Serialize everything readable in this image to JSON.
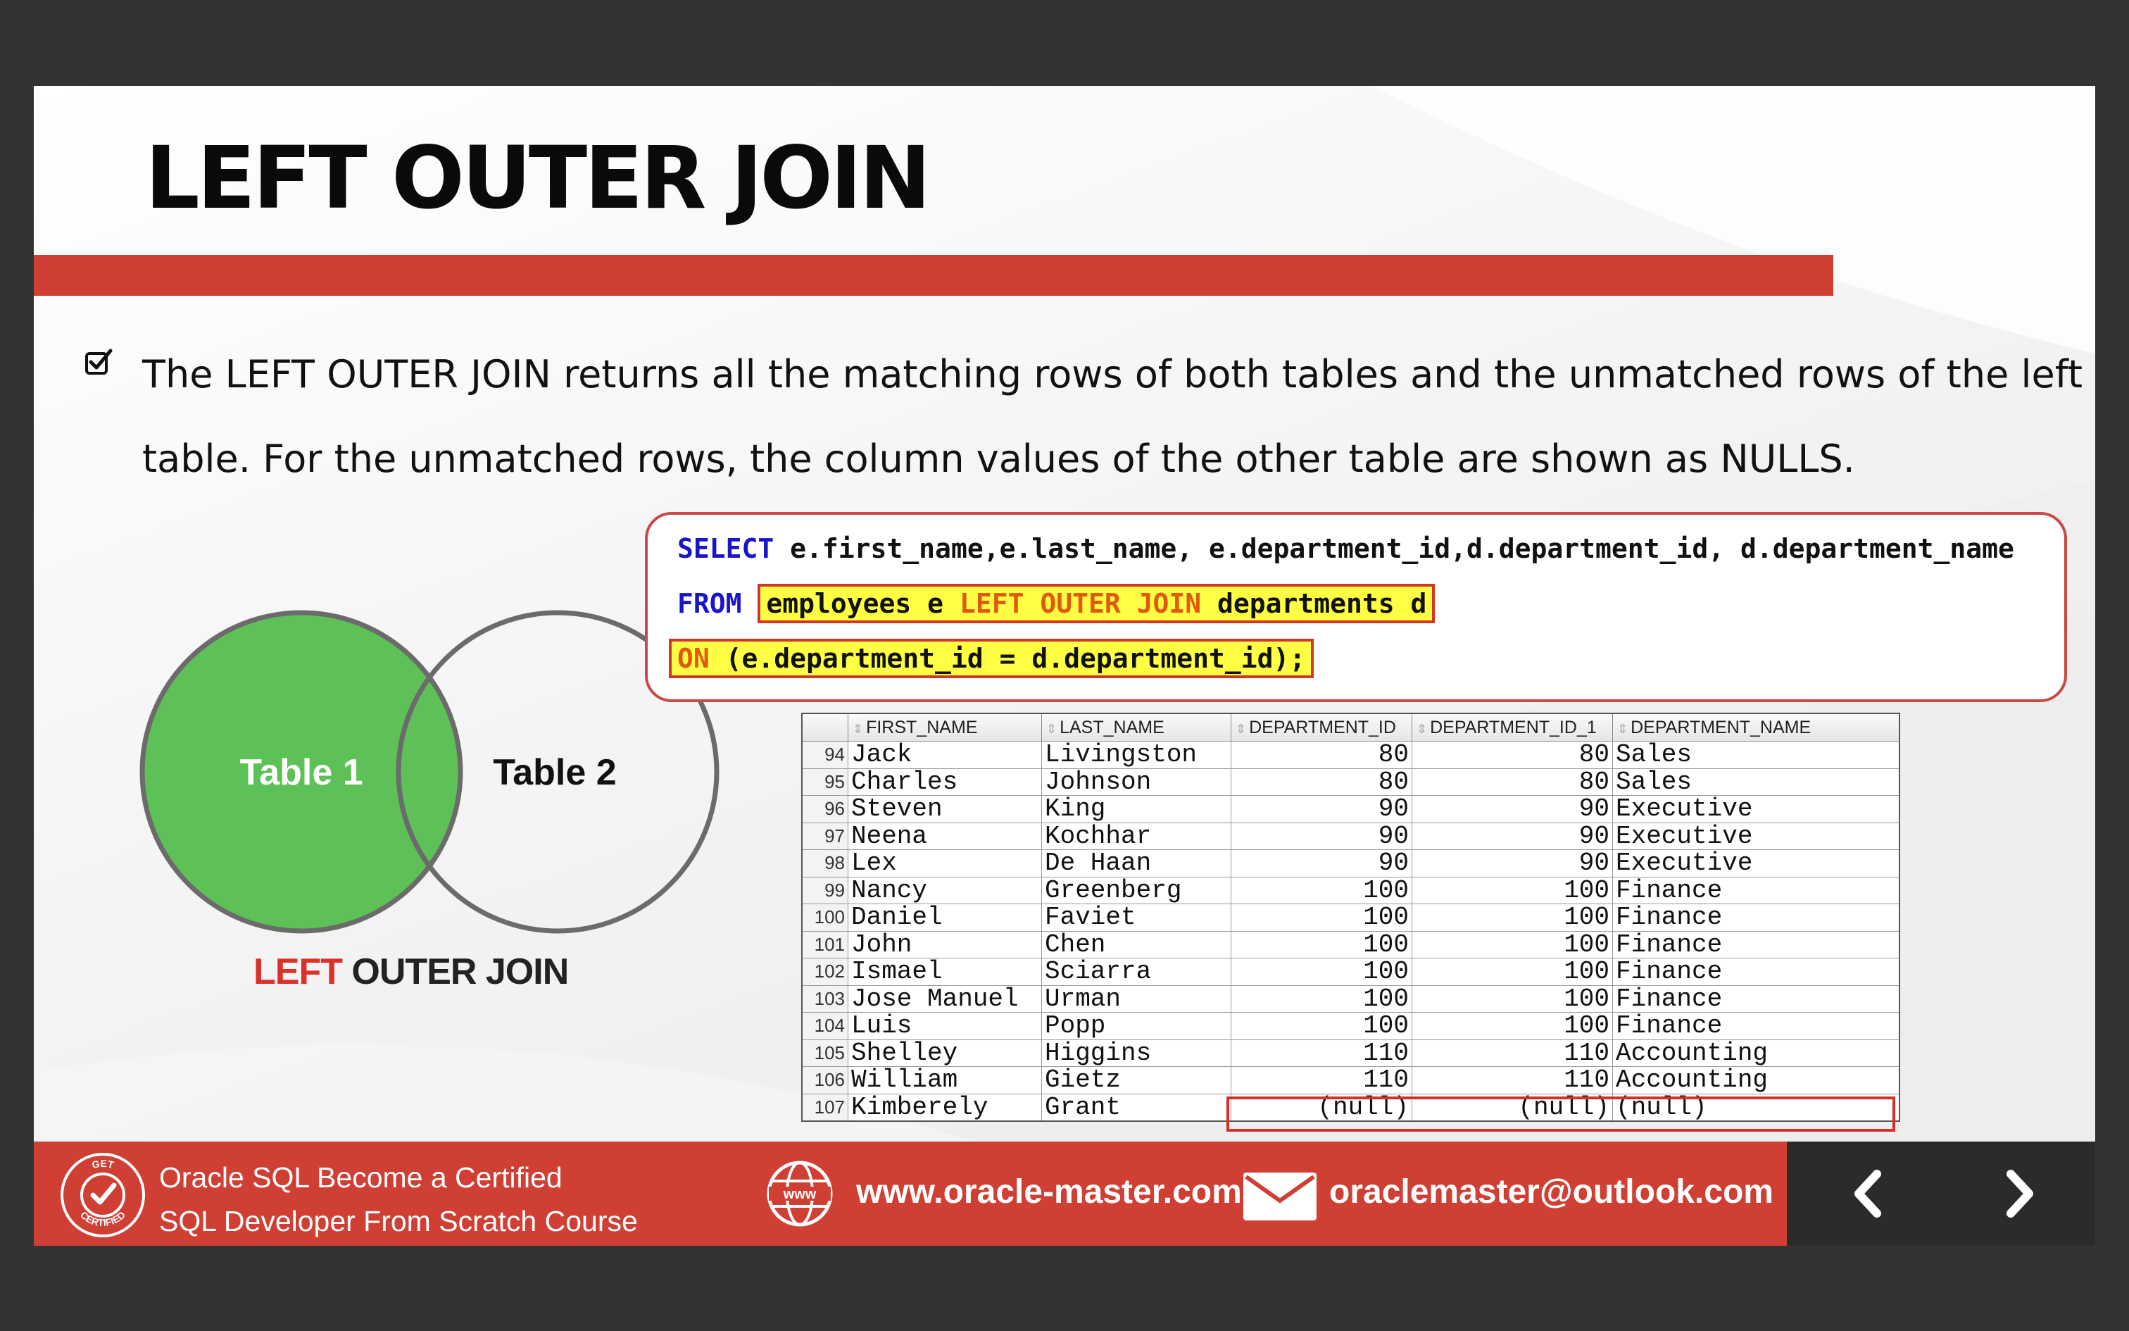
{
  "slide": {
    "title": "LEFT OUTER JOIN",
    "bullet": "The LEFT OUTER JOIN returns all the matching rows of both tables and the unmatched rows of the left table. For the unmatched rows, the column values of the other table are shown as NULLS."
  },
  "venn": {
    "table1": "Table 1",
    "table2": "Table 2",
    "caption_left": "LEFT",
    "caption_rest": " OUTER JOIN",
    "fill_color": "#5ec157"
  },
  "code": {
    "line1_kw": "SELECT",
    "line1_rest": " e.first_name,e.last_name, e.department_id,d.department_id, d.department_name",
    "line2_kw": "FROM",
    "line2_a": "employees e ",
    "line2_join": "LEFT OUTER JOIN",
    "line2_b": " departments d",
    "line3_kw": "ON",
    "line3_rest": " (e.department_id = d.department_id);"
  },
  "results": {
    "columns": [
      "FIRST_NAME",
      "LAST_NAME",
      "DEPARTMENT_ID",
      "DEPARTMENT_ID_1",
      "DEPARTMENT_NAME"
    ],
    "rows": [
      [
        "94",
        "Jack",
        "Livingston",
        "80",
        "80",
        "Sales"
      ],
      [
        "95",
        "Charles",
        "Johnson",
        "80",
        "80",
        "Sales"
      ],
      [
        "96",
        "Steven",
        "King",
        "90",
        "90",
        "Executive"
      ],
      [
        "97",
        "Neena",
        "Kochhar",
        "90",
        "90",
        "Executive"
      ],
      [
        "98",
        "Lex",
        "De Haan",
        "90",
        "90",
        "Executive"
      ],
      [
        "99",
        "Nancy",
        "Greenberg",
        "100",
        "100",
        "Finance"
      ],
      [
        "100",
        "Daniel",
        "Faviet",
        "100",
        "100",
        "Finance"
      ],
      [
        "101",
        "John",
        "Chen",
        "100",
        "100",
        "Finance"
      ],
      [
        "102",
        "Ismael",
        "Sciarra",
        "100",
        "100",
        "Finance"
      ],
      [
        "103",
        "Jose Manuel",
        "Urman",
        "100",
        "100",
        "Finance"
      ],
      [
        "104",
        "Luis",
        "Popp",
        "100",
        "100",
        "Finance"
      ],
      [
        "105",
        "Shelley",
        "Higgins",
        "110",
        "110",
        "Accounting"
      ],
      [
        "106",
        "William",
        "Gietz",
        "110",
        "110",
        "Accounting"
      ],
      [
        "107",
        "Kimberely",
        "Grant",
        "(null)",
        "(null)",
        "(null)"
      ]
    ]
  },
  "footer": {
    "course_line1": "Oracle SQL Become a Certified",
    "course_line2": "SQL  Developer  From Scratch Course",
    "website": "www.oracle-master.com",
    "email": "oraclemaster@outlook.com",
    "badge_top": "GET",
    "badge_bottom": "CERTIFIED",
    "www_label": "www"
  },
  "colors": {
    "accent_red": "#cf3f33",
    "venn_green": "#5ec157",
    "sql_keyword_blue": "#1a14c8",
    "sql_keyword_orange": "#e4580c",
    "highlight_yellow": "#ffff44"
  }
}
